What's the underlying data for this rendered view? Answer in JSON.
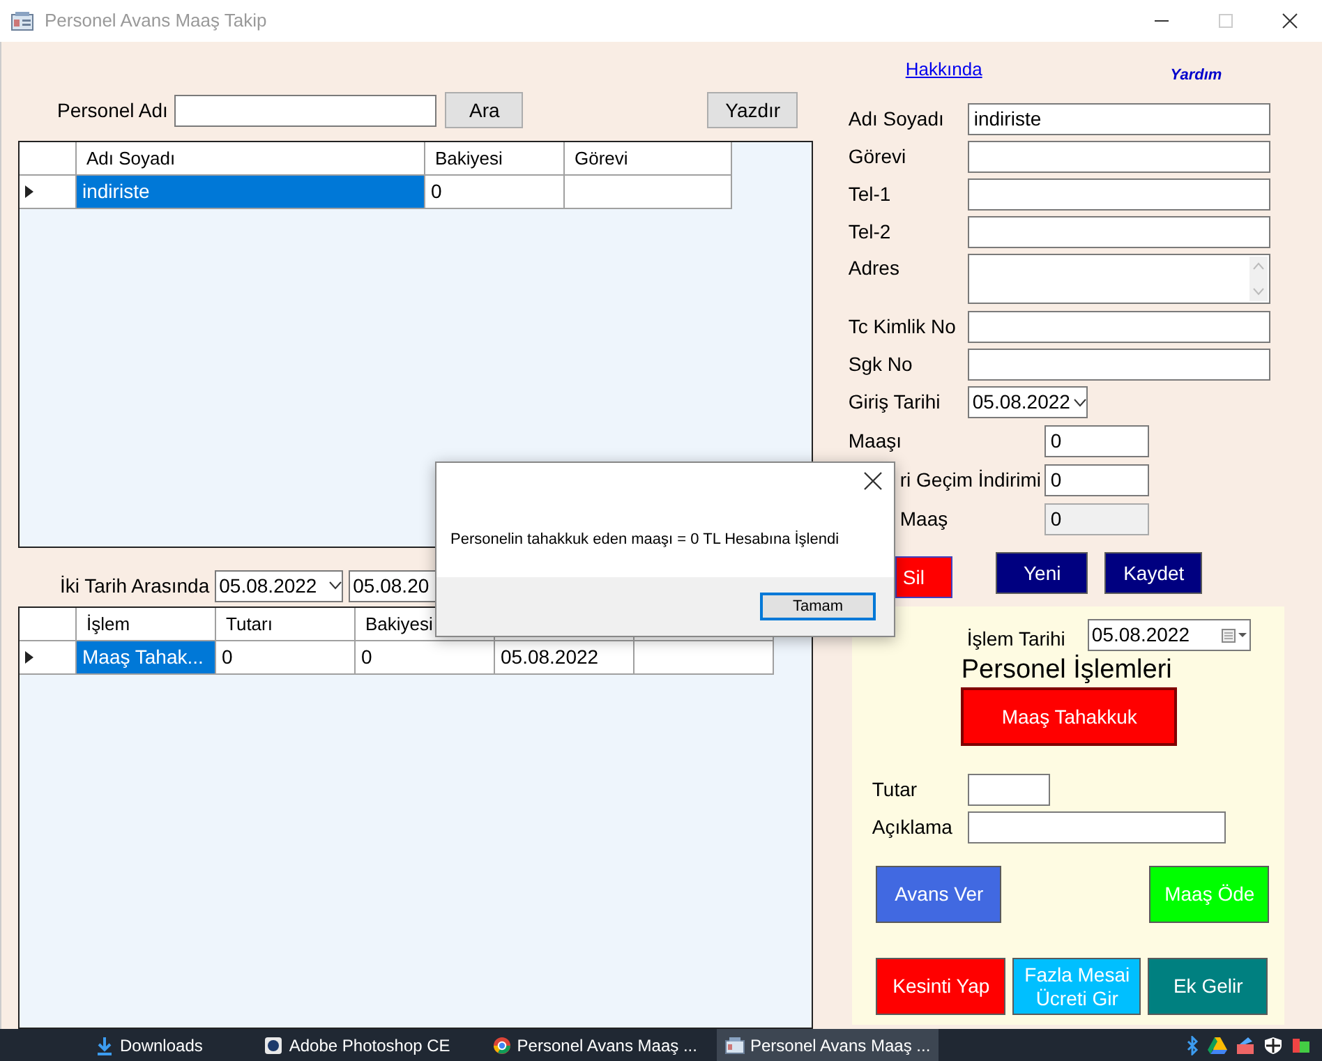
{
  "window": {
    "title": "Personel Avans Maaş Takip"
  },
  "search": {
    "label": "Personel Adı",
    "button": "Ara",
    "print_button": "Yazdır"
  },
  "staff_grid": {
    "columns": [
      "Adı Soyadı",
      "Bakiyesi",
      "Görevi"
    ],
    "rows": [
      {
        "cells": [
          "indiriste",
          "0",
          null
        ],
        "selected": true
      }
    ]
  },
  "date_range": {
    "label": "İki Tarih Arasında",
    "from": "05.08.2022",
    "to": "05.08.20"
  },
  "transactions_grid": {
    "columns": [
      "İşlem",
      "Tutarı",
      "Bakiyesi",
      null,
      null
    ],
    "rows": [
      {
        "cells": [
          "Maaş Tahak...",
          "0",
          "0",
          "05.08.2022",
          null
        ],
        "selected": true
      }
    ]
  },
  "links": [
    {
      "label": "Hakkında",
      "kind": "link"
    },
    {
      "label": "Yardım",
      "kind": "help"
    }
  ],
  "fields": [
    {
      "label": "Adı Soyadı",
      "value": "indiriste",
      "kind": "text"
    },
    {
      "label": "Görevi",
      "kind": "text"
    },
    {
      "label": "Tel-1",
      "kind": "text"
    },
    {
      "label": "Tel-2",
      "kind": "text"
    },
    {
      "label": "Adres",
      "kind": "textarea"
    },
    {
      "label": "Tc Kimlik No",
      "kind": "text"
    },
    {
      "label": "Sgk No",
      "kind": "text"
    },
    {
      "label": "Giriş Tarihi",
      "value": "05.08.2022",
      "kind": "date"
    },
    {
      "label": "Maaşı",
      "value": "0",
      "kind": "short",
      "obscured": false,
      "disabled": false
    },
    {
      "label": "ri Geçim İndirimi",
      "value": "0",
      "kind": "short",
      "obscured": true,
      "disabled": false
    },
    {
      "label": "Maaş",
      "value": "0",
      "kind": "short",
      "obscured": true,
      "disabled": true
    }
  ],
  "buttons": [
    {
      "label": "Sil",
      "color": "#ff0000",
      "obscured": true
    },
    {
      "label": "Yeni",
      "color": "#000080",
      "obscured": false
    },
    {
      "label": "Kaydet",
      "color": "#000080",
      "obscured": false
    }
  ],
  "operations": {
    "date_label": "İşlem Tarihi",
    "date": "05.08.2022",
    "title": "Personel İşlemleri",
    "main_button": {
      "label": "Maaş Tahakkuk",
      "color": "#ff0000"
    },
    "fields": [
      {
        "label": "Tutar",
        "kind": "short"
      },
      {
        "label": "Açıklama",
        "kind": "long"
      }
    ],
    "button_rows": [
      [
        {
          "label": "Avans Ver",
          "color": "#4169e1"
        },
        {
          "label": "Maaş Öde",
          "color": "#00ff00"
        }
      ],
      [
        {
          "label": "Kesinti Yap",
          "color": "#ff0000"
        },
        {
          "label": "Fazla Mesai Ücreti Gir",
          "color": "#00bfff"
        },
        {
          "label": "Ek Gelir",
          "color": "#008080"
        }
      ]
    ]
  },
  "dialog": {
    "message": "Personelin tahakkuk eden maaşı = 0 TL Hesabına İşlendi",
    "button": "Tamam"
  },
  "taskbar": {
    "items": [
      {
        "label": "Downloads",
        "kind": "downloads",
        "selected": false
      },
      {
        "label": "Adobe Photoshop CE",
        "kind": "photoshop",
        "selected": false
      },
      {
        "label": "Personel Avans Maaş ...",
        "kind": "browser",
        "selected": false
      },
      {
        "label": "Personel Avans Maaş ...",
        "kind": "app",
        "selected": true
      }
    ]
  }
}
